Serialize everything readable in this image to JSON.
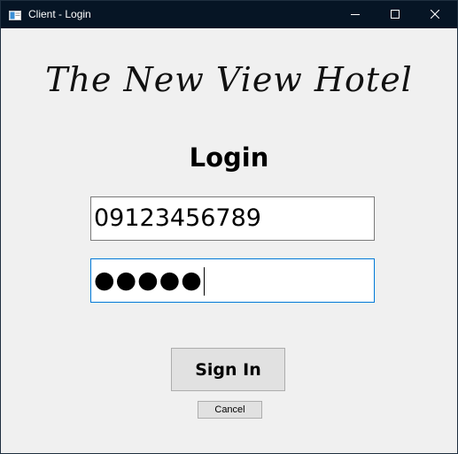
{
  "window": {
    "title": "Client - Login",
    "icons": {
      "app": "app-window-icon",
      "minimize": "minimize-icon",
      "maximize": "maximize-icon",
      "close": "close-icon"
    }
  },
  "header": {
    "hotel_name": "The New View Hotel",
    "heading": "Login"
  },
  "form": {
    "phone_value": "09123456789",
    "password_mask": "●●●●●"
  },
  "buttons": {
    "sign_in_label": "Sign In",
    "cancel_label": "Cancel"
  },
  "colors": {
    "titlebar": "#061525",
    "client_bg": "#f0f0f0",
    "focus_border": "#0078d7",
    "button_bg": "#e1e1e1"
  }
}
